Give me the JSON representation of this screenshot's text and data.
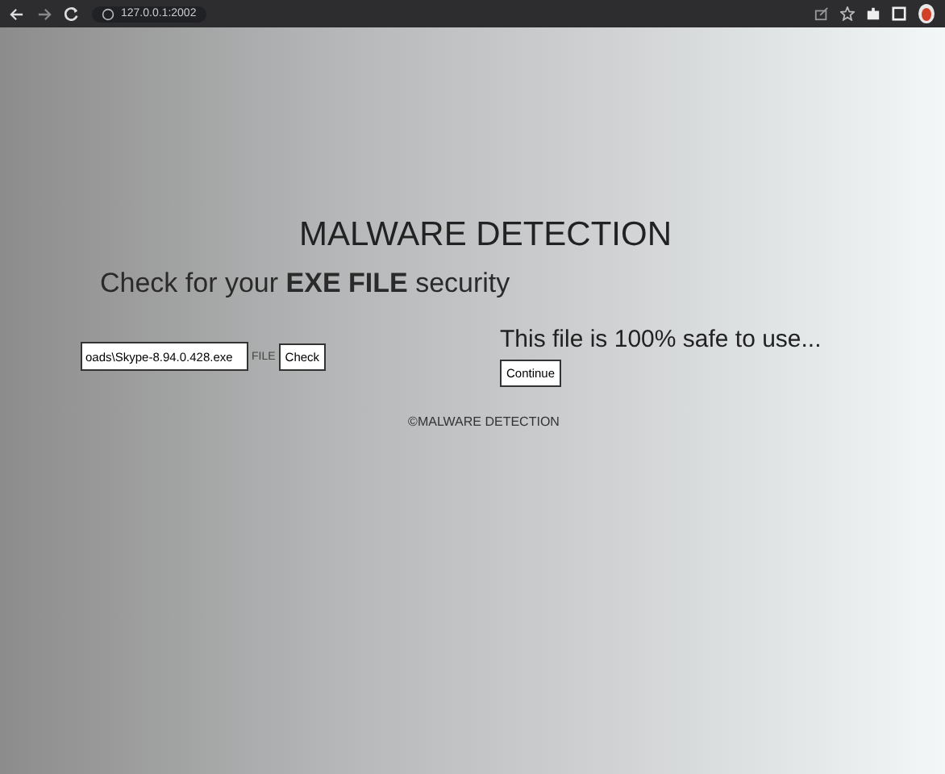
{
  "browser": {
    "url": "127.0.0.1:2002"
  },
  "page": {
    "title": "MALWARE DETECTION",
    "subtitle": "Check for your **EXE FILE** security",
    "file_field": {
      "value": "oads\\Skype-8.94.0.428.exe",
      "label": "FILE"
    },
    "check_button": "Check",
    "result": "This file is 100% safe to use...",
    "continue_button": "Continue",
    "footer": "©MALWARE DETECTION"
  }
}
